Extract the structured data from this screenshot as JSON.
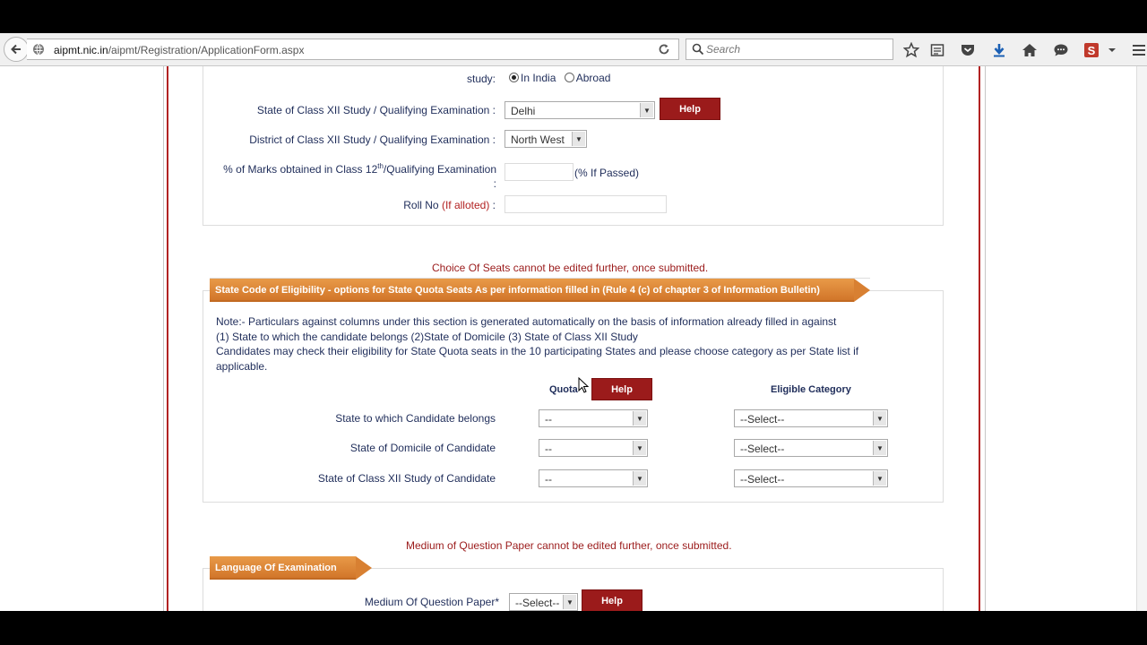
{
  "browser": {
    "url_domain": "aipmt.nic.in",
    "url_path": "/aipmt/Registration/ApplicationForm.aspx",
    "search_placeholder": "Search"
  },
  "section1": {
    "study_label": "study:",
    "study_options": [
      "In India",
      "Abroad"
    ],
    "study_selected": "In India",
    "state_label": "State of Class XII Study / Qualifying Examination :",
    "state_value": "Delhi",
    "help_label": "Help",
    "district_label": "District of Class XII Study / Qualifying Examination :",
    "district_value": "North West",
    "marks_label_pre": "% of Marks obtained in Class 12",
    "marks_label_sup": "th",
    "marks_label_post": "/Qualifying Examination",
    "marks_colon": ":",
    "marks_hint": "(% If Passed)",
    "roll_label": "Roll No",
    "roll_hint": "(If alloted)",
    "roll_colon": ":"
  },
  "section2": {
    "warning": "Choice Of Seats cannot be edited further, once submitted.",
    "tab_title": "State Code of Eligibility - options for State Quota Seats As per information filled in (Rule 4 (c) of chapter 3 of Information Bulletin)",
    "note_lines": [
      "Note:- Particulars against columns under this section is generated automatically on the basis of information already filled in against",
      "(1) State to which the candidate belongs (2)State of Domicile (3) State of Class XII Study",
      "Candidates may check their eligibility for State Quota seats in the 10 participating States and please choose category as per State list if",
      "applicable."
    ],
    "quota_header": "Quota",
    "help_label": "Help",
    "category_header": "Eligible Category",
    "rows": [
      {
        "label": "State to which Candidate belongs",
        "quota": "--",
        "category": "--Select--"
      },
      {
        "label": "State of Domicile of Candidate",
        "quota": "--",
        "category": "--Select--"
      },
      {
        "label": "State of Class XII Study of Candidate",
        "quota": "--",
        "category": "--Select--"
      }
    ]
  },
  "section3": {
    "warning": "Medium of Question Paper cannot be edited further, once submitted.",
    "tab_title": "Language Of Examination",
    "medium_label": "Medium Of Question Paper*",
    "medium_value": "--Select--",
    "help_label": "Help"
  }
}
